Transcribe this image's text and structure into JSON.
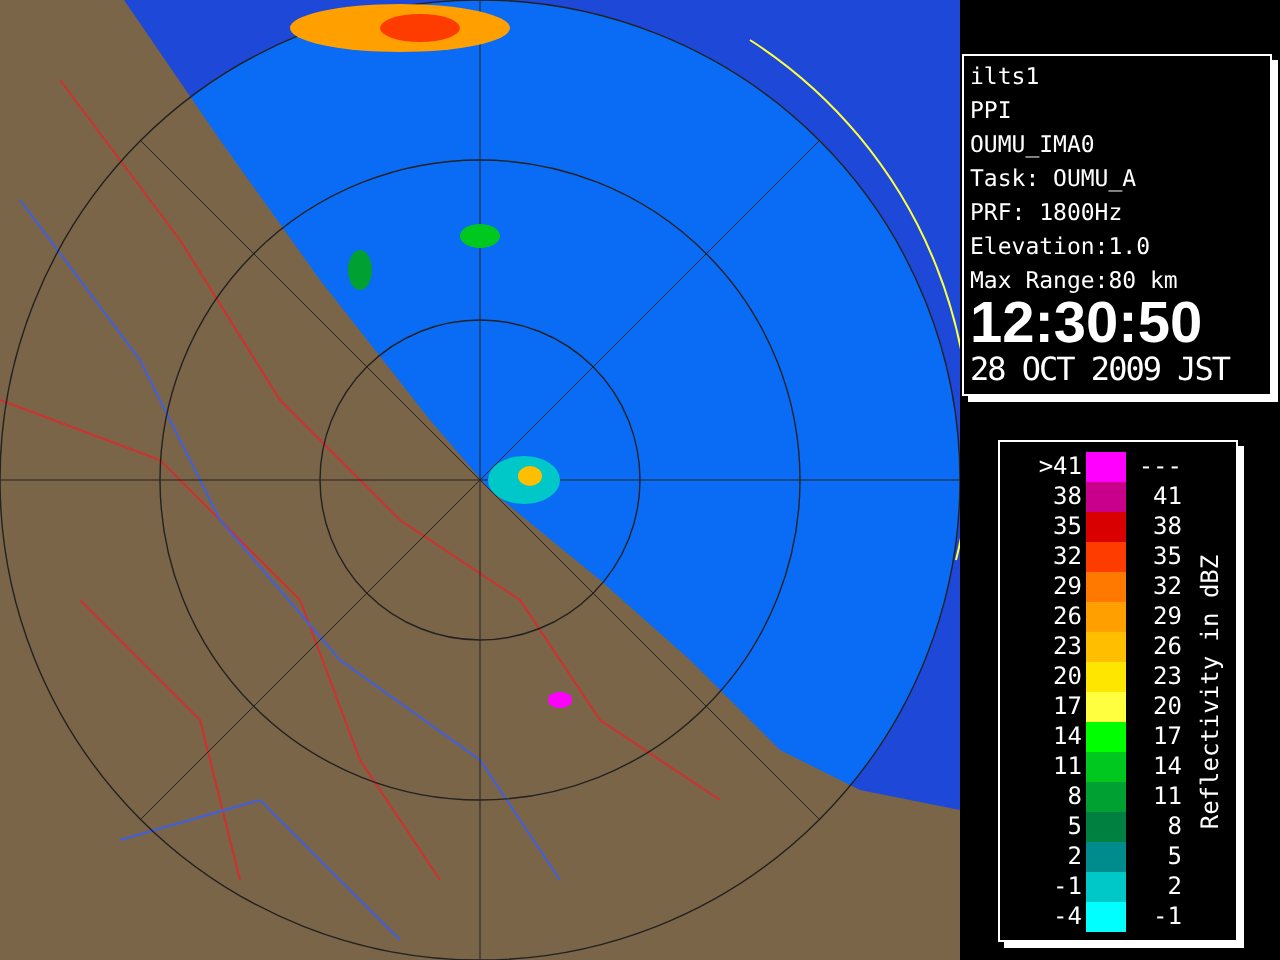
{
  "info": {
    "lines": [
      "ilts1",
      "PPI",
      "OUMU_IMA0",
      "Task: OUMU_A",
      "PRF: 1800Hz",
      "Elevation:1.0",
      "Max Range:80 km"
    ],
    "time": "12:30:50",
    "date": "28 OCT 2009 JST"
  },
  "legend": {
    "title": "Reflectivity in dBZ",
    "rows": [
      {
        "low": ">41",
        "high": "---",
        "color": "#ff00ff"
      },
      {
        "low": "38",
        "high": "41",
        "color": "#c8008c"
      },
      {
        "low": "35",
        "high": "38",
        "color": "#d80000"
      },
      {
        "low": "32",
        "high": "35",
        "color": "#ff3c00"
      },
      {
        "low": "29",
        "high": "32",
        "color": "#ff7800"
      },
      {
        "low": "26",
        "high": "29",
        "color": "#ffa000"
      },
      {
        "low": "23",
        "high": "26",
        "color": "#ffbe00"
      },
      {
        "low": "20",
        "high": "23",
        "color": "#ffe600"
      },
      {
        "low": "17",
        "high": "20",
        "color": "#ffff40"
      },
      {
        "low": "14",
        "high": "17",
        "color": "#00ff00"
      },
      {
        "low": "11",
        "high": "14",
        "color": "#00c81e"
      },
      {
        "low": "8",
        "high": "11",
        "color": "#00a032"
      },
      {
        "low": "5",
        "high": "8",
        "color": "#008040"
      },
      {
        "low": "2",
        "high": "5",
        "color": "#008c8c"
      },
      {
        "low": "-1",
        "high": "2",
        "color": "#00c8c8"
      },
      {
        "low": "-4",
        "high": "-1",
        "color": "#00ffff"
      }
    ]
  }
}
